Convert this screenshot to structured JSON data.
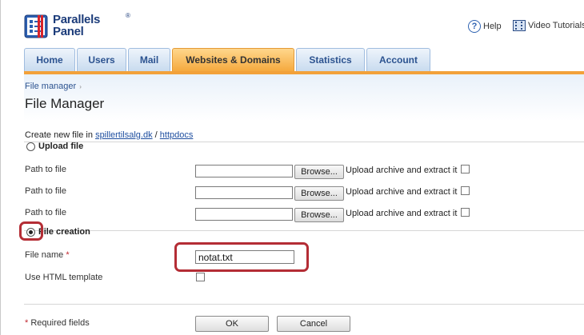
{
  "header": {
    "logo_line1": "Parallels",
    "logo_line2": "Panel",
    "logo_reg": "®",
    "help_label": "Help",
    "video_label": "Video Tutorials"
  },
  "tabs": [
    {
      "label": "Home",
      "active": false
    },
    {
      "label": "Users",
      "active": false
    },
    {
      "label": "Mail",
      "active": false
    },
    {
      "label": "Websites & Domains",
      "active": true
    },
    {
      "label": "Statistics",
      "active": false
    },
    {
      "label": "Account",
      "active": false
    }
  ],
  "breadcrumb": {
    "item": "File manager",
    "separator": "›"
  },
  "page_title": "File Manager",
  "create_in": {
    "prefix": "Create new file in",
    "domain": "spillertilsalg.dk",
    "separator": "/",
    "folder": "httpdocs"
  },
  "upload": {
    "label": "Upload file",
    "selected": false,
    "rows": [
      {
        "label": "Path to file",
        "browse": "Browse...",
        "extract": "Upload archive and extract it",
        "checked": false
      },
      {
        "label": "Path to file",
        "browse": "Browse...",
        "extract": "Upload archive and extract it",
        "checked": false
      },
      {
        "label": "Path to file",
        "browse": "Browse...",
        "extract": "Upload archive and extract it",
        "checked": false
      }
    ]
  },
  "creation": {
    "label": "File creation",
    "selected": true,
    "file_name_label": "File name",
    "required_mark": "*",
    "file_name_value": "notat.txt",
    "html_template_label": "Use HTML template",
    "html_template_checked": false
  },
  "footer": {
    "required_mark": "*",
    "required_text": "Required fields",
    "ok_label": "OK",
    "cancel_label": "Cancel"
  },
  "colors": {
    "active_tab": "#f5a93e",
    "tab_text": "#2c5390",
    "link": "#1f4fa0",
    "highlight": "#b42d35"
  }
}
